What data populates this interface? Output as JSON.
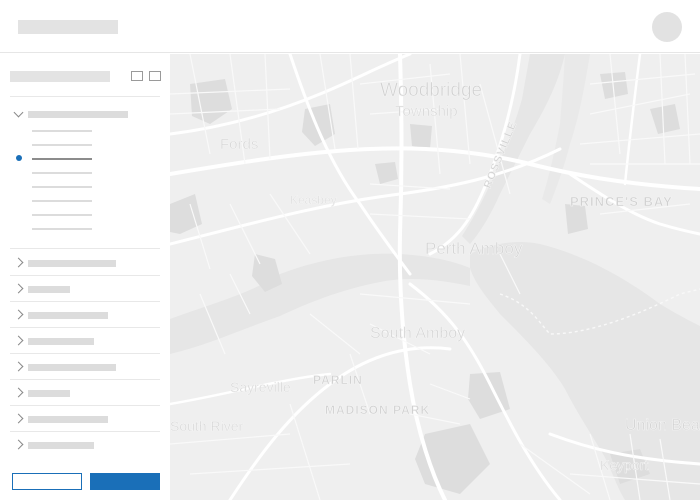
{
  "map": {
    "labels": {
      "woodbridge": "Woodbridge",
      "township": "Township",
      "fords": "Fords",
      "keasbey": "Keasbey",
      "perth_amboy": "Perth Amboy",
      "south_amboy": "South Amboy",
      "sayreville": "Sayreville",
      "parlin": "PARLIN",
      "madison_park": "MADISON PARK",
      "south_river": "South River",
      "union_beach": "Union Beach",
      "princes_bay": "PRINCE'S BAY",
      "rossville": "ROSSVILLE",
      "keyport": "Keyport"
    }
  },
  "colors": {
    "accent": "#1a6fb8",
    "placeholder": "#e3e3e3",
    "map_land": "#efefef",
    "map_water": "#e6e6e6",
    "map_park": "#dddddd",
    "map_road": "#ffffff"
  }
}
